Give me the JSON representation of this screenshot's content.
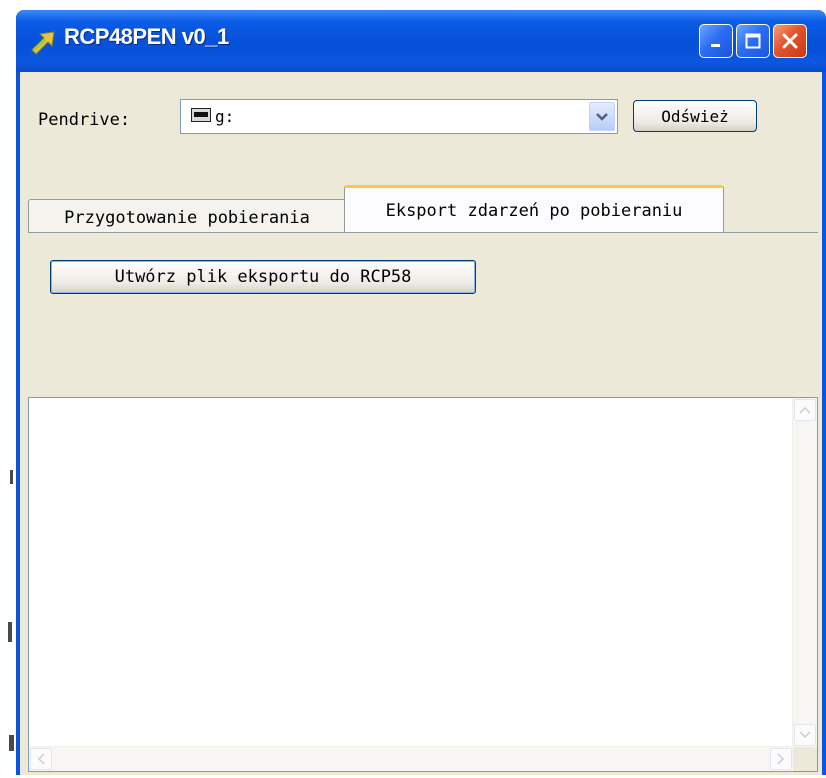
{
  "window": {
    "title": "RCP48PEN v0_1"
  },
  "pendrive": {
    "label": "Pendrive:",
    "value": "g:",
    "refresh_label": "Odśwież"
  },
  "tabs": [
    {
      "label": "Przygotowanie pobierania",
      "active": false
    },
    {
      "label": "Eksport zdarzeń po pobieraniu",
      "active": true
    }
  ],
  "export": {
    "button_label": "Utwórz plik eksportu do RCP58"
  },
  "log": {
    "text": ""
  },
  "colors": {
    "titlebar": "#0a54e0",
    "client": "#ece9d8",
    "close": "#e2542c",
    "active_tab_accent": "#ffc83c"
  },
  "icons": [
    "app-arrow-icon",
    "drive-icon",
    "chevron-down-icon",
    "minimize-icon",
    "maximize-icon",
    "close-icon",
    "scroll-up-icon",
    "scroll-down-icon",
    "scroll-left-icon",
    "scroll-right-icon"
  ]
}
